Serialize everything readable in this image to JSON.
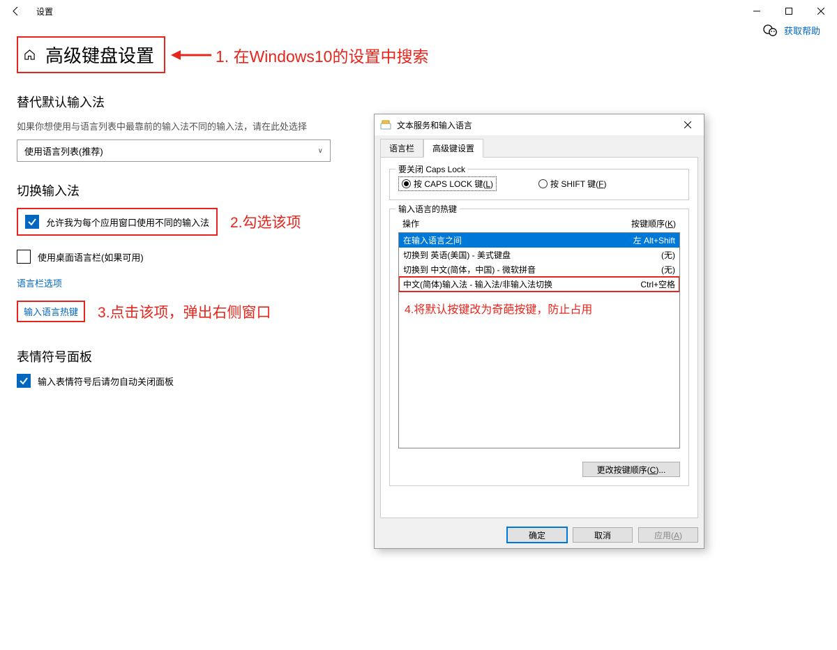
{
  "window": {
    "title": "设置"
  },
  "page": {
    "title": "高级键盘设置",
    "help_label": "获取帮助"
  },
  "annotations": {
    "a1": "1. 在Windows10的设置中搜索",
    "a2": "2.勾选该项",
    "a3": "3.点击该项，弹出右侧窗口",
    "a4": "4.将默认按键改为奇葩按键，防止占用"
  },
  "section_default": {
    "heading": "替代默认输入法",
    "desc": "如果你想使用与语言列表中最靠前的输入法不同的输入法，请在此处选择",
    "dropdown_value": "使用语言列表(推荐)"
  },
  "section_switch": {
    "heading": "切换输入法",
    "cb1_label": "允许我为每个应用窗口使用不同的输入法",
    "cb1_checked": true,
    "cb2_label": "使用桌面语言栏(如果可用)",
    "cb2_checked": false,
    "link_langbar": "语言栏选项",
    "link_hotkeys": "输入语言热键"
  },
  "section_emoji": {
    "heading": "表情符号面板",
    "cb_label": "输入表情符号后请勿自动关闭面板",
    "cb_checked": true
  },
  "dialog": {
    "title": "文本服务和输入语言",
    "tab_langbar": "语言栏",
    "tab_adv": "高级键设置",
    "group_caps_title": "要关闭 Caps Lock",
    "radio_caps_pre": "按 CAPS LOCK 键(",
    "radio_caps_key": "L",
    "radio_caps_post": ")",
    "radio_shift_pre": "按 SHIFT 键(",
    "radio_shift_key": "F",
    "radio_shift_post": ")",
    "group_hotkeys_title": "输入语言的热键",
    "col_action": "操作",
    "col_keys_pre": "按键顺序(",
    "col_keys_key": "K",
    "col_keys_post": ")",
    "rows": [
      {
        "action": "在输入语言之间",
        "keys": "左 Alt+Shift",
        "selected": true
      },
      {
        "action": "切换到 英语(美国) - 美式键盘",
        "keys": "(无)"
      },
      {
        "action": "切换到 中文(简体，中国) - 微软拼音",
        "keys": "(无)"
      },
      {
        "action": "中文(简体)输入法 - 输入法/非输入法切换",
        "keys": "Ctrl+空格",
        "highlighted": true
      }
    ],
    "change_btn_pre": "更改按键顺序(",
    "change_btn_key": "C",
    "change_btn_post": ")...",
    "ok": "确定",
    "cancel": "取消",
    "apply_pre": "应用(",
    "apply_key": "A",
    "apply_post": ")"
  }
}
